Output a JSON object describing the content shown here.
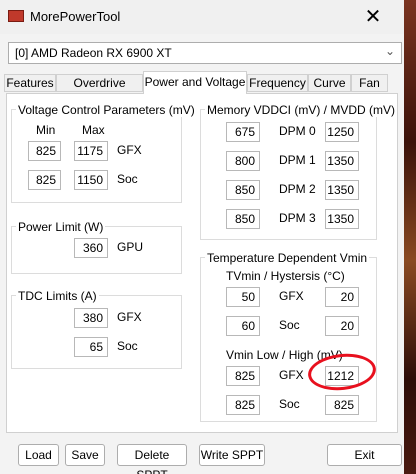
{
  "window": {
    "title": "MorePowerTool",
    "icon": "app-icon",
    "close_glyph": "✕"
  },
  "gpu_select": {
    "value": "[0] AMD Radeon RX 6900 XT",
    "arrow_glyph": "⌄"
  },
  "tabs": [
    {
      "label": "Features"
    },
    {
      "label": "Overdrive Limits"
    },
    {
      "label": "Power and Voltage",
      "active": true
    },
    {
      "label": "Frequency"
    },
    {
      "label": "Curve"
    },
    {
      "label": "Fan"
    }
  ],
  "voltage": {
    "title": "Voltage Control Parameters (mV)",
    "min_label": "Min",
    "max_label": "Max",
    "gfx_label": "GFX",
    "soc_label": "Soc",
    "gfx_min": "825",
    "gfx_max": "1175",
    "soc_min": "825",
    "soc_max": "1150"
  },
  "power": {
    "title": "Power Limit (W)",
    "gpu_value": "360",
    "gpu_label": "GPU"
  },
  "tdc": {
    "title": "TDC Limits (A)",
    "gfx_value": "380",
    "gfx_label": "GFX",
    "soc_value": "65",
    "soc_label": "Soc"
  },
  "memory": {
    "title": "Memory VDDCI (mV) / MVDD (mV)",
    "rows": [
      {
        "label": "DPM 0",
        "vddci": "675",
        "mvdd": "1250"
      },
      {
        "label": "DPM 1",
        "vddci": "800",
        "mvdd": "1350"
      },
      {
        "label": "DPM 2",
        "vddci": "850",
        "mvdd": "1350"
      },
      {
        "label": "DPM 3",
        "vddci": "850",
        "mvdd": "1350"
      }
    ]
  },
  "temp": {
    "title": "Temperature Dependent Vmin",
    "tvmin_label": "TVmin / Hystersis (°C)",
    "tv_gfx_a": "50",
    "tv_gfx_label": "GFX",
    "tv_gfx_b": "20",
    "tv_soc_a": "60",
    "tv_soc_label": "Soc",
    "tv_soc_b": "20",
    "vmin_label": "Vmin Low / High (mV)",
    "vm_gfx_low": "825",
    "vm_gfx_label": "GFX",
    "vm_gfx_high": "1212",
    "vm_soc_low": "825",
    "vm_soc_label": "Soc",
    "vm_soc_high": "825"
  },
  "annotation_color": "#e8101e",
  "buttons": {
    "load": "Load",
    "save": "Save",
    "delete": "Delete SPPT",
    "write": "Write SPPT",
    "exit": "Exit"
  }
}
